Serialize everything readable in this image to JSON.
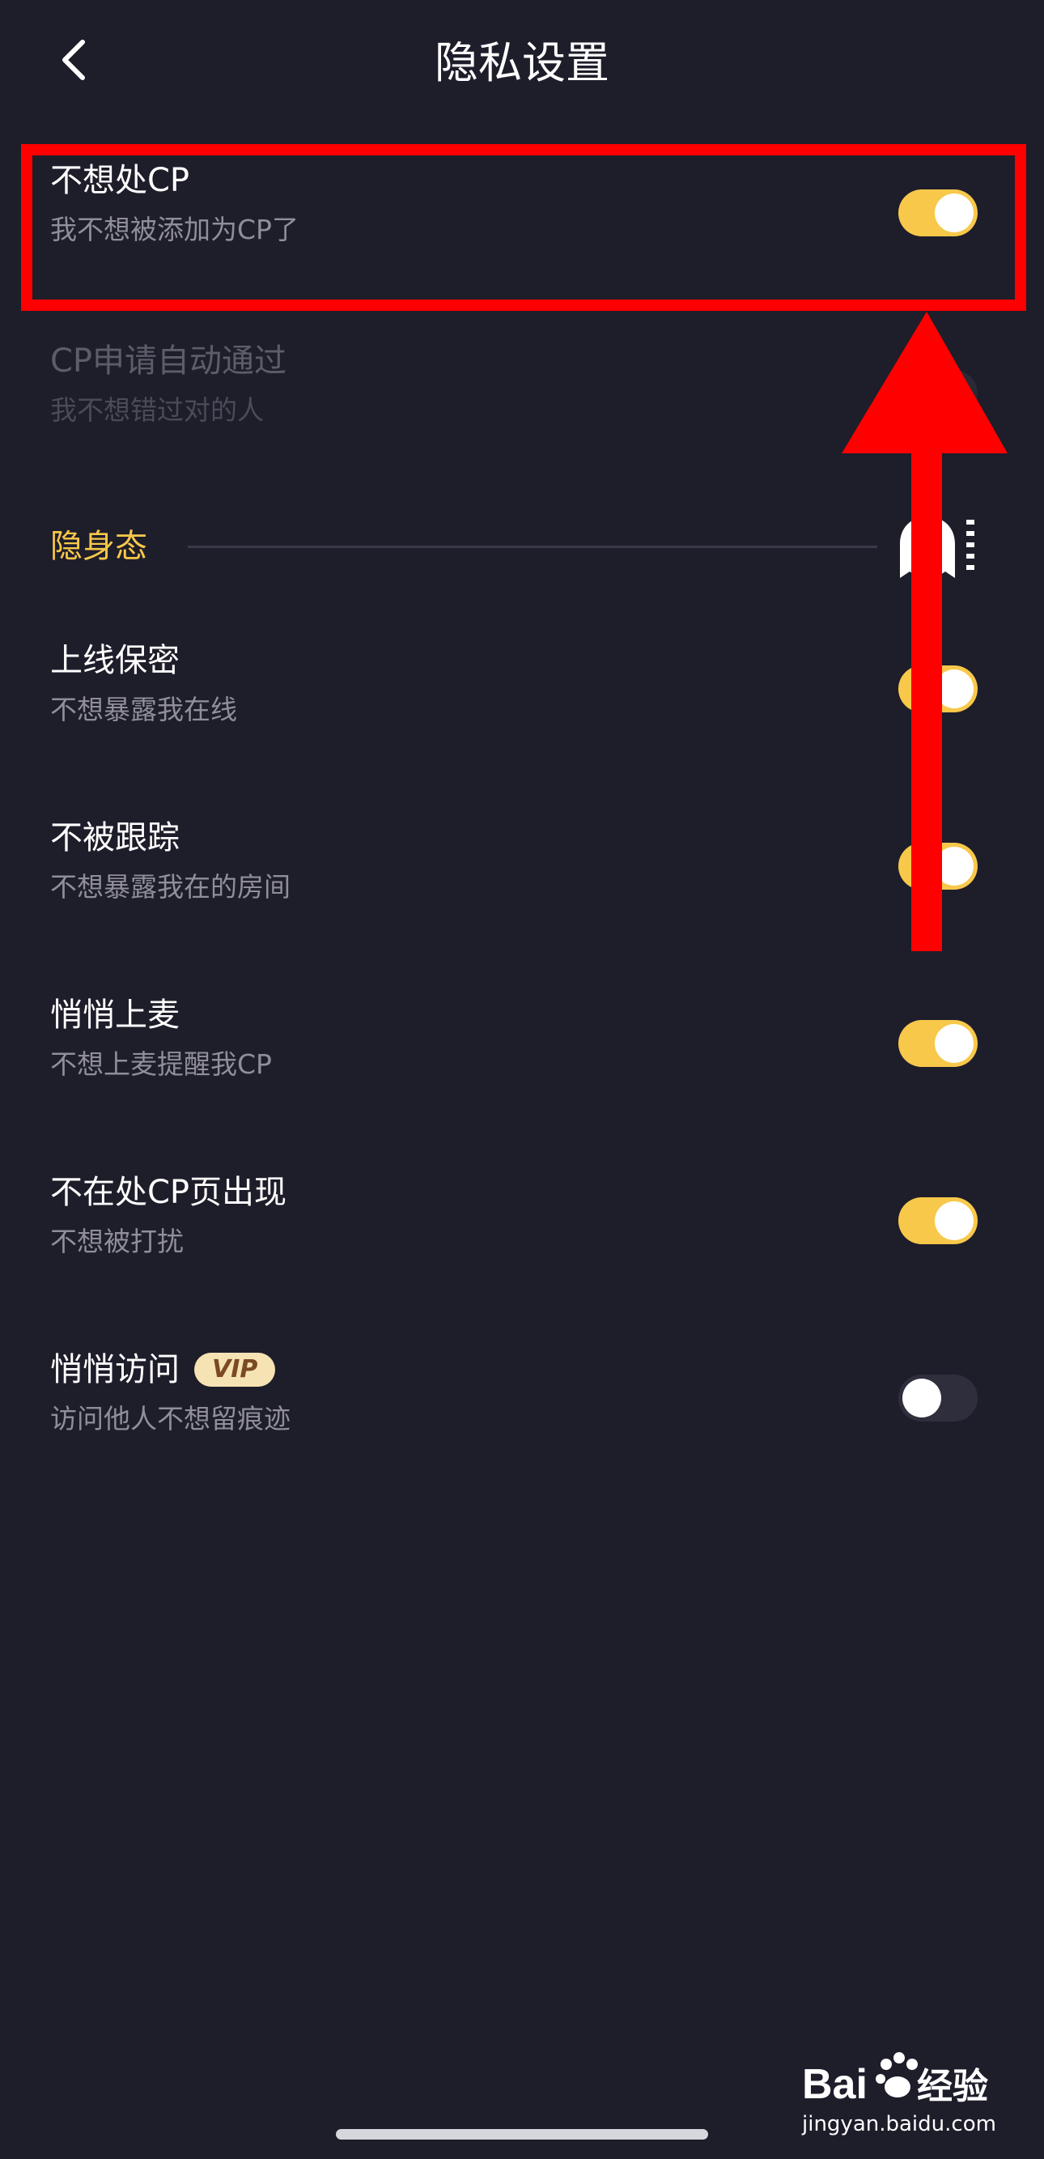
{
  "header": {
    "title": "隐私设置",
    "back_icon": "chevron-left-icon"
  },
  "settings_top": [
    {
      "title": "不想处CP",
      "subtitle": "我不想被添加为CP了",
      "enabled": true,
      "disabled": false
    },
    {
      "title": "CP申请自动通过",
      "subtitle": "我不想错过对的人",
      "enabled": false,
      "disabled": true
    }
  ],
  "section": {
    "label": "隐身态",
    "icon": "ghost-icon"
  },
  "settings_stealth": [
    {
      "title": "上线保密",
      "subtitle": "不想暴露我在线",
      "enabled": true
    },
    {
      "title": "不被跟踪",
      "subtitle": "不想暴露我在的房间",
      "enabled": true
    },
    {
      "title": "悄悄上麦",
      "subtitle": "不想上麦提醒我CP",
      "enabled": true
    },
    {
      "title": "不在处CP页出现",
      "subtitle": "不想被打扰",
      "enabled": true
    },
    {
      "title": "悄悄访问",
      "badge": "VIP",
      "subtitle": "访问他人不想留痕迹",
      "enabled": false
    }
  ],
  "watermark": {
    "brand": "Bai",
    "brand_suffix": "经验",
    "url": "jingyan.baidu.com"
  },
  "colors": {
    "background": "#1e1d2a",
    "accent": "#f7c84a",
    "annotation": "#ff0000"
  }
}
